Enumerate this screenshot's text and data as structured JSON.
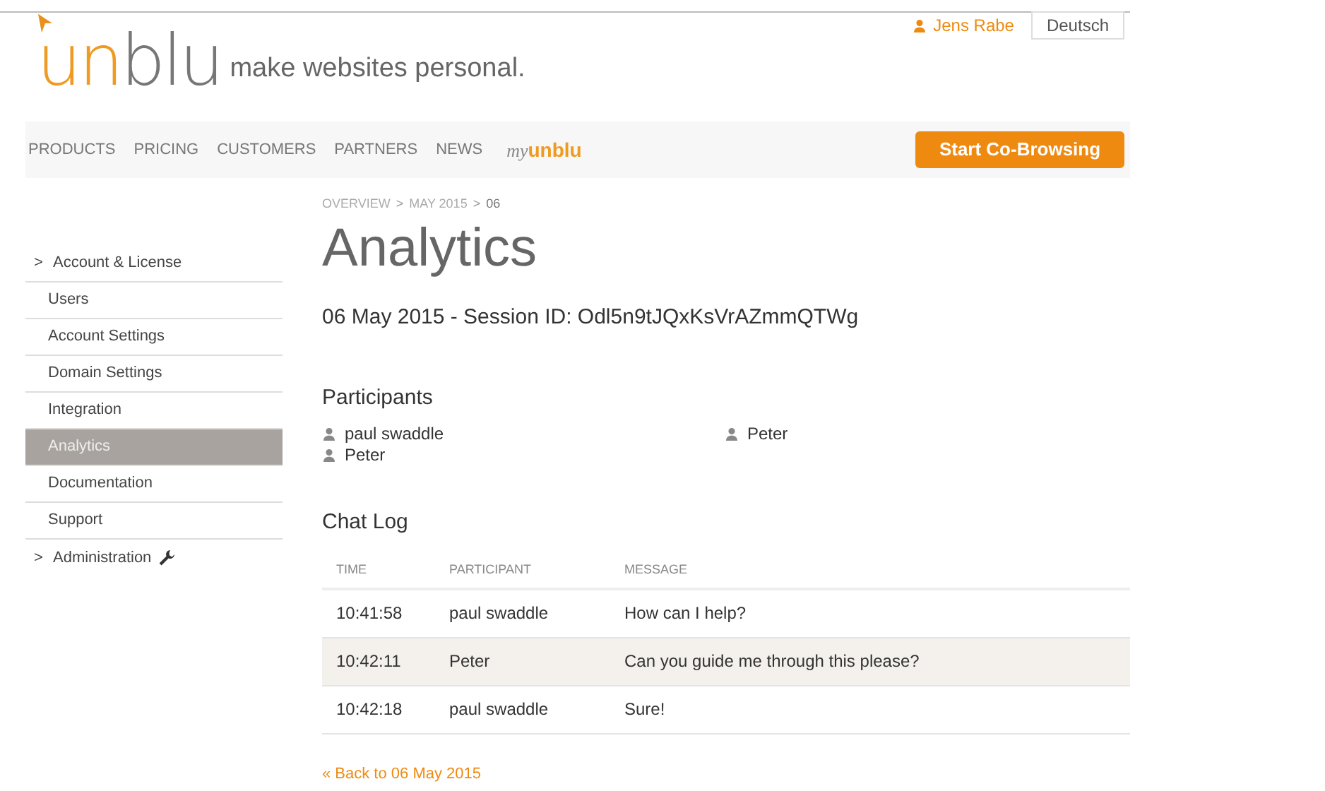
{
  "header": {
    "user": "Jens Rabe",
    "language_button": "Deutsch",
    "logo": {
      "part_1": "un",
      "part_2": "blu"
    },
    "tagline": "make websites personal."
  },
  "nav": {
    "items": [
      {
        "label": "PRODUCTS",
        "kind": "link"
      },
      {
        "label": "PRICING",
        "kind": "link"
      },
      {
        "label": "CUSTOMERS",
        "kind": "link"
      },
      {
        "label": "PARTNERS",
        "kind": "link"
      },
      {
        "label": "NEWS",
        "kind": "link"
      },
      {
        "prefix": "my",
        "label": "unblu",
        "kind": "brand"
      }
    ],
    "cta_button": "Start Co-Browsing"
  },
  "sidebar": {
    "items": [
      {
        "label": "Account & License",
        "kind": "section",
        "marker": ">",
        "selected": false,
        "wrench": false
      },
      {
        "label": "Users",
        "kind": "item",
        "selected": false,
        "wrench": false
      },
      {
        "label": "Account Settings",
        "kind": "item",
        "selected": false,
        "wrench": false
      },
      {
        "label": "Domain Settings",
        "kind": "item",
        "selected": false,
        "wrench": false
      },
      {
        "label": "Integration",
        "kind": "item",
        "selected": false,
        "wrench": false
      },
      {
        "label": "Analytics",
        "kind": "item",
        "selected": true,
        "wrench": false
      },
      {
        "label": "Documentation",
        "kind": "item",
        "selected": false,
        "wrench": false
      },
      {
        "label": "Support",
        "kind": "item",
        "selected": false,
        "wrench": false
      },
      {
        "label": "Administration",
        "kind": "section",
        "marker": ">",
        "selected": false,
        "wrench": true
      }
    ]
  },
  "breadcrumb": [
    {
      "label": "OVERVIEW",
      "kind": "link"
    },
    {
      "label": ">",
      "kind": "separator"
    },
    {
      "label": "MAY 2015",
      "kind": "link"
    },
    {
      "label": ">",
      "kind": "separator"
    },
    {
      "label": "06",
      "kind": "current"
    }
  ],
  "title": "Analytics",
  "session": "06 May 2015 - Session ID: Odl5n9tJQxKsVrAZmmQTWg",
  "participants": {
    "heading": "Participants",
    "columns": [
      [
        "paul swaddle",
        "Peter"
      ],
      [
        "Peter"
      ]
    ]
  },
  "chat_log": {
    "heading": "Chat Log",
    "columns": [
      "TIME",
      "PARTICIPANT",
      "MESSAGE"
    ],
    "rows": [
      {
        "cells": [
          "10:41:58",
          "paul swaddle",
          "How can I help?"
        ],
        "highlighted": false
      },
      {
        "cells": [
          "10:42:11",
          "Peter",
          "Can you guide me through this please?"
        ],
        "highlighted": true
      },
      {
        "cells": [
          "10:42:18",
          "paul swaddle",
          "Sure!"
        ],
        "highlighted": false
      }
    ]
  },
  "back_link": "« Back to 06 May 2015"
}
